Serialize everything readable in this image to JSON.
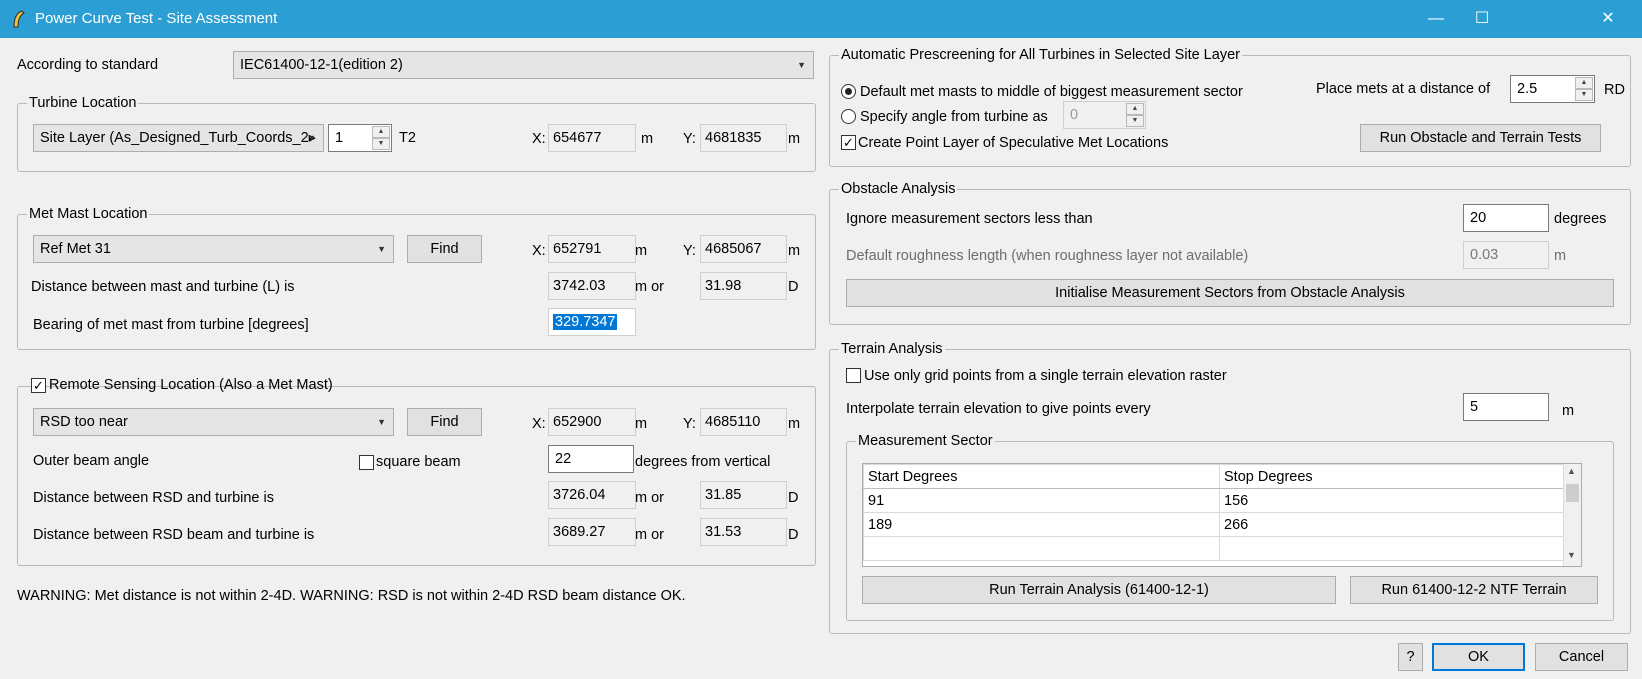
{
  "window": {
    "title": "Power Curve Test - Site Assessment",
    "minimize": "—",
    "maximize": "☐",
    "close": "✕"
  },
  "standard": {
    "label": "According to standard",
    "value": "IEC61400-12-1(edition 2)"
  },
  "turbine_location": {
    "title": "Turbine Location",
    "layer": "Site Layer (As_Designed_Turb_Coords_2⁠▸",
    "index": "1",
    "name": "T2",
    "x_label": "X:",
    "x": "654677",
    "x_unit": "m",
    "y_label": "Y:",
    "y": "4681835",
    "y_unit": "m"
  },
  "met_mast": {
    "title": "Met Mast Location",
    "mast": "Ref Met 31",
    "find_label": "Find",
    "x_label": "X:",
    "x": "652791",
    "x_unit": "m",
    "y_label": "Y:",
    "y": "4685067",
    "y_unit": "m",
    "distance_label": "Distance between mast and turbine (L) is",
    "distance_m": "3742.03",
    "distance_or": "m or",
    "distance_d": "31.98",
    "distance_d_unit": "D",
    "bearing_label": "Bearing of met mast from turbine [degrees]",
    "bearing": "329.7347"
  },
  "remote_sensing": {
    "title": "Remote Sensing Location (Also a Met Mast)",
    "checked": "✓",
    "device": "RSD too near",
    "find_label": "Find",
    "x_label": "X:",
    "x": "652900",
    "x_unit": "m",
    "y_label": "Y:",
    "y": "4685110",
    "y_unit": "m",
    "beam_angle_label": "Outer beam angle",
    "square_beam_label": "square beam",
    "beam_angle": "22",
    "beam_angle_unit": "degrees from vertical",
    "rsd_distance_label": "Distance between RSD and turbine is",
    "rsd_distance_m": "3726.04",
    "rsd_distance_or": "m or",
    "rsd_distance_d": "31.85",
    "rsd_distance_d_unit": "D",
    "beam_distance_label": "Distance between RSD beam and turbine is",
    "beam_distance_m": "3689.27",
    "beam_distance_or": "m or",
    "beam_distance_d": "31.53",
    "beam_distance_d_unit": "D"
  },
  "warning": "WARNING: Met distance is not within 2-4D. WARNING: RSD is not within 2-4D RSD beam distance OK.",
  "prescreening": {
    "title": "Automatic Prescreening for All Turbines in Selected Site Layer",
    "default_radio": "Default met masts to middle of biggest measurement sector",
    "angle_radio": "Specify angle from turbine as",
    "angle_value": "0",
    "point_layer_label": "Create Point Layer of Speculative Met Locations",
    "point_layer_checked": "✓",
    "distance_label": "Place mets at a distance of",
    "distance_value": "2.5",
    "distance_unit": "RD",
    "run_button": "Run Obstacle and Terrain Tests"
  },
  "obstacle": {
    "title": "Obstacle Analysis",
    "ignore_label": "Ignore measurement sectors less than",
    "ignore_value": "20",
    "ignore_unit": "degrees",
    "roughness_label": "Default roughness length (when roughness layer not available)",
    "roughness_value": "0.03",
    "roughness_unit": "m",
    "init_button": "Initialise Measurement Sectors from Obstacle Analysis"
  },
  "terrain": {
    "title": "Terrain Analysis",
    "single_raster_label": "Use only grid points from a single terrain elevation raster",
    "interpolate_label": "Interpolate terrain elevation to give points every",
    "interpolate_value": "5",
    "interpolate_unit": "m",
    "sector_title": "Measurement Sector",
    "columns": [
      "Start Degrees",
      "Stop Degrees"
    ],
    "rows": [
      [
        "91",
        "156"
      ],
      [
        "189",
        "266"
      ],
      [
        "",
        ""
      ]
    ],
    "run_terrain_button": "Run Terrain Analysis (61400-12-1)",
    "run_ntf_button": "Run 61400-12-2 NTF  Terrain"
  },
  "footer": {
    "help": "?",
    "ok": "OK",
    "cancel": "Cancel"
  }
}
